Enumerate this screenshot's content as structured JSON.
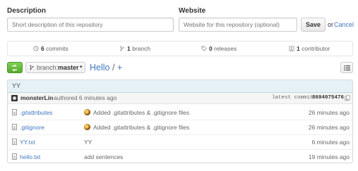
{
  "form": {
    "description_label": "Description",
    "description_placeholder": "Short description of this repository",
    "website_label": "Website",
    "website_placeholder": "Website for this repository (optional)",
    "save_label": "Save",
    "or_text": "or",
    "cancel_label": "Cancel"
  },
  "stats": {
    "commits_count": "6",
    "commits_label": "commits",
    "branch_count": "1",
    "branch_label": "branch",
    "releases_count": "0",
    "releases_label": "releases",
    "contributor_count": "1",
    "contributor_label": "contributor"
  },
  "toolbar": {
    "branch_prefix": "branch:",
    "branch_name": "master",
    "repo_name": "Hello",
    "path_separator": "/",
    "add_symbol": "+"
  },
  "latest_commit": {
    "message": "YY",
    "author": "monsterLin",
    "authored_text": "authored 6 minutes ago",
    "latest_label": "latest commit",
    "sha": "8694075476"
  },
  "files": [
    {
      "name": ".gitattributes",
      "message": "Added .gitattributes & .gitignore files",
      "age": "26 minutes ago",
      "emoji": true
    },
    {
      "name": ".gitignore",
      "message": "Added .gitattributes & .gitignore files",
      "age": "26 minutes ago",
      "emoji": true
    },
    {
      "name": "YY.txt",
      "message": "YY",
      "age": "6 minutes ago",
      "emoji": false
    },
    {
      "name": "hello.txt",
      "message": "add sentences",
      "age": "19 minutes ago",
      "emoji": false
    }
  ],
  "colors": {
    "link": "#4078c0",
    "green_button": "#6cc644",
    "header_bg": "#e6f1f6"
  }
}
